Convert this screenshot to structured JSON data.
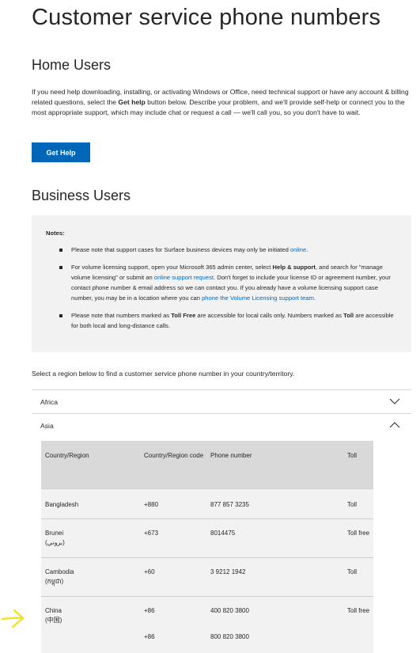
{
  "page": {
    "title": "Customer service phone numbers"
  },
  "home": {
    "heading": "Home Users",
    "intro_part1": "If you need help downloading, installing, or activating Windows or Office, need technical support or have any account & billing related questions, select the ",
    "intro_bold": "Get help",
    "intro_part2": " button below. Describe your problem, and we'll provide self-help or connect you to the most appropriate support, which may include chat or request a call — we'll call you, so you don't have to wait.",
    "get_help_label": "Get Help"
  },
  "business": {
    "heading": "Business Users",
    "notes_title": "Notes:",
    "note1_text": "Please note that support cases for Surface business devices may only be initiated ",
    "note1_link": "online",
    "note1_end": ".",
    "note2_a": "For volume licensing support, open your Microsoft 365 admin center, select ",
    "note2_bold": "Help & support",
    "note2_b": ", and search for \"manage volume licensing\" or submit an ",
    "note2_link1": "online support request",
    "note2_c": ". Don't forget to include your license ID or agreement number, your contact phone number & email address so we can contact you. If you already have a volume licensing support case number, you may be in a location where you can ",
    "note2_link2": "phone the Volume Licensing support team",
    "note2_d": ".",
    "note3_a": "Please note that numbers marked as ",
    "note3_bold1": "Toll Free",
    "note3_b": " are accessible for local calls only. Numbers marked as ",
    "note3_bold2": "Toll",
    "note3_c": " are accessible for both local and long-distance calls."
  },
  "regions": {
    "intro": "Select a region below to find a customer service phone number in your country/territory.",
    "africa_label": "Africa",
    "asia_label": "Asia"
  },
  "table": {
    "headers": {
      "country": "Country/Region",
      "code": "Country/Region code",
      "phone": "Phone number",
      "toll": "Toll"
    },
    "rows": [
      {
        "country": "Bangladesh",
        "native": "",
        "code": "+880",
        "phone": "877 857 3235",
        "toll": "Toll"
      },
      {
        "country": "Brunei",
        "native": "(بروني)",
        "code": "+673",
        "phone": "8014475",
        "toll": "Toll free"
      },
      {
        "country": "Cambodia",
        "native": "(កម្ពុជា)",
        "code": "+60",
        "phone": "3 9212 1942",
        "toll": "Toll"
      },
      {
        "country": "China",
        "native": "(中国)",
        "code": "+86",
        "phone": "400 820 3800",
        "toll": "Toll free",
        "code2": "+86",
        "phone2": "800 820 3800"
      }
    ]
  },
  "colors": {
    "accent": "#0067b8",
    "annotation_arrow": "#f5e21b",
    "notes_background": "#f2f2f2",
    "table_header_background": "#d9d9d9"
  },
  "icons": {
    "africa_chevron": "chevron-down-icon",
    "asia_chevron": "chevron-up-icon",
    "annotation": "hand-drawn-arrow-icon"
  }
}
